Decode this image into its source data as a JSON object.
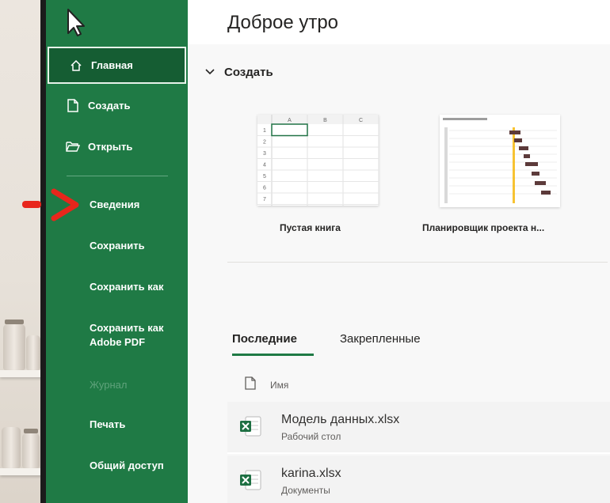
{
  "greeting": "Доброе утро",
  "sidebar": {
    "items": [
      {
        "label": "Главная",
        "icon": "home-icon"
      },
      {
        "label": "Создать",
        "icon": "new-document-icon"
      },
      {
        "label": "Открыть",
        "icon": "folder-open-icon"
      },
      {
        "label": "Сведения"
      },
      {
        "label": "Сохранить"
      },
      {
        "label": "Сохранить как"
      },
      {
        "label": "Сохранить как Adobe PDF"
      },
      {
        "label": "Журнал"
      },
      {
        "label": "Печать"
      },
      {
        "label": "Общий доступ"
      }
    ]
  },
  "create_section": {
    "title": "Создать",
    "templates": [
      {
        "name": "Пустая книга"
      },
      {
        "name": "Планировщик проекта н..."
      }
    ]
  },
  "tabs": [
    {
      "label": "Последние"
    },
    {
      "label": "Закрепленные"
    }
  ],
  "files": {
    "column_name": "Имя",
    "rows": [
      {
        "name": "Модель данных.xlsx",
        "location": "Рабочий стол"
      },
      {
        "name": "karina.xlsx",
        "location": "Документы"
      }
    ]
  },
  "blank_sheet": {
    "columns": [
      "A",
      "B",
      "C"
    ],
    "rows": [
      "1",
      "2",
      "3",
      "4",
      "5",
      "6",
      "7"
    ]
  },
  "colors": {
    "sidebar": "#1f7a45",
    "accent_dark": "#155d33",
    "annotation": "#e8261c"
  }
}
